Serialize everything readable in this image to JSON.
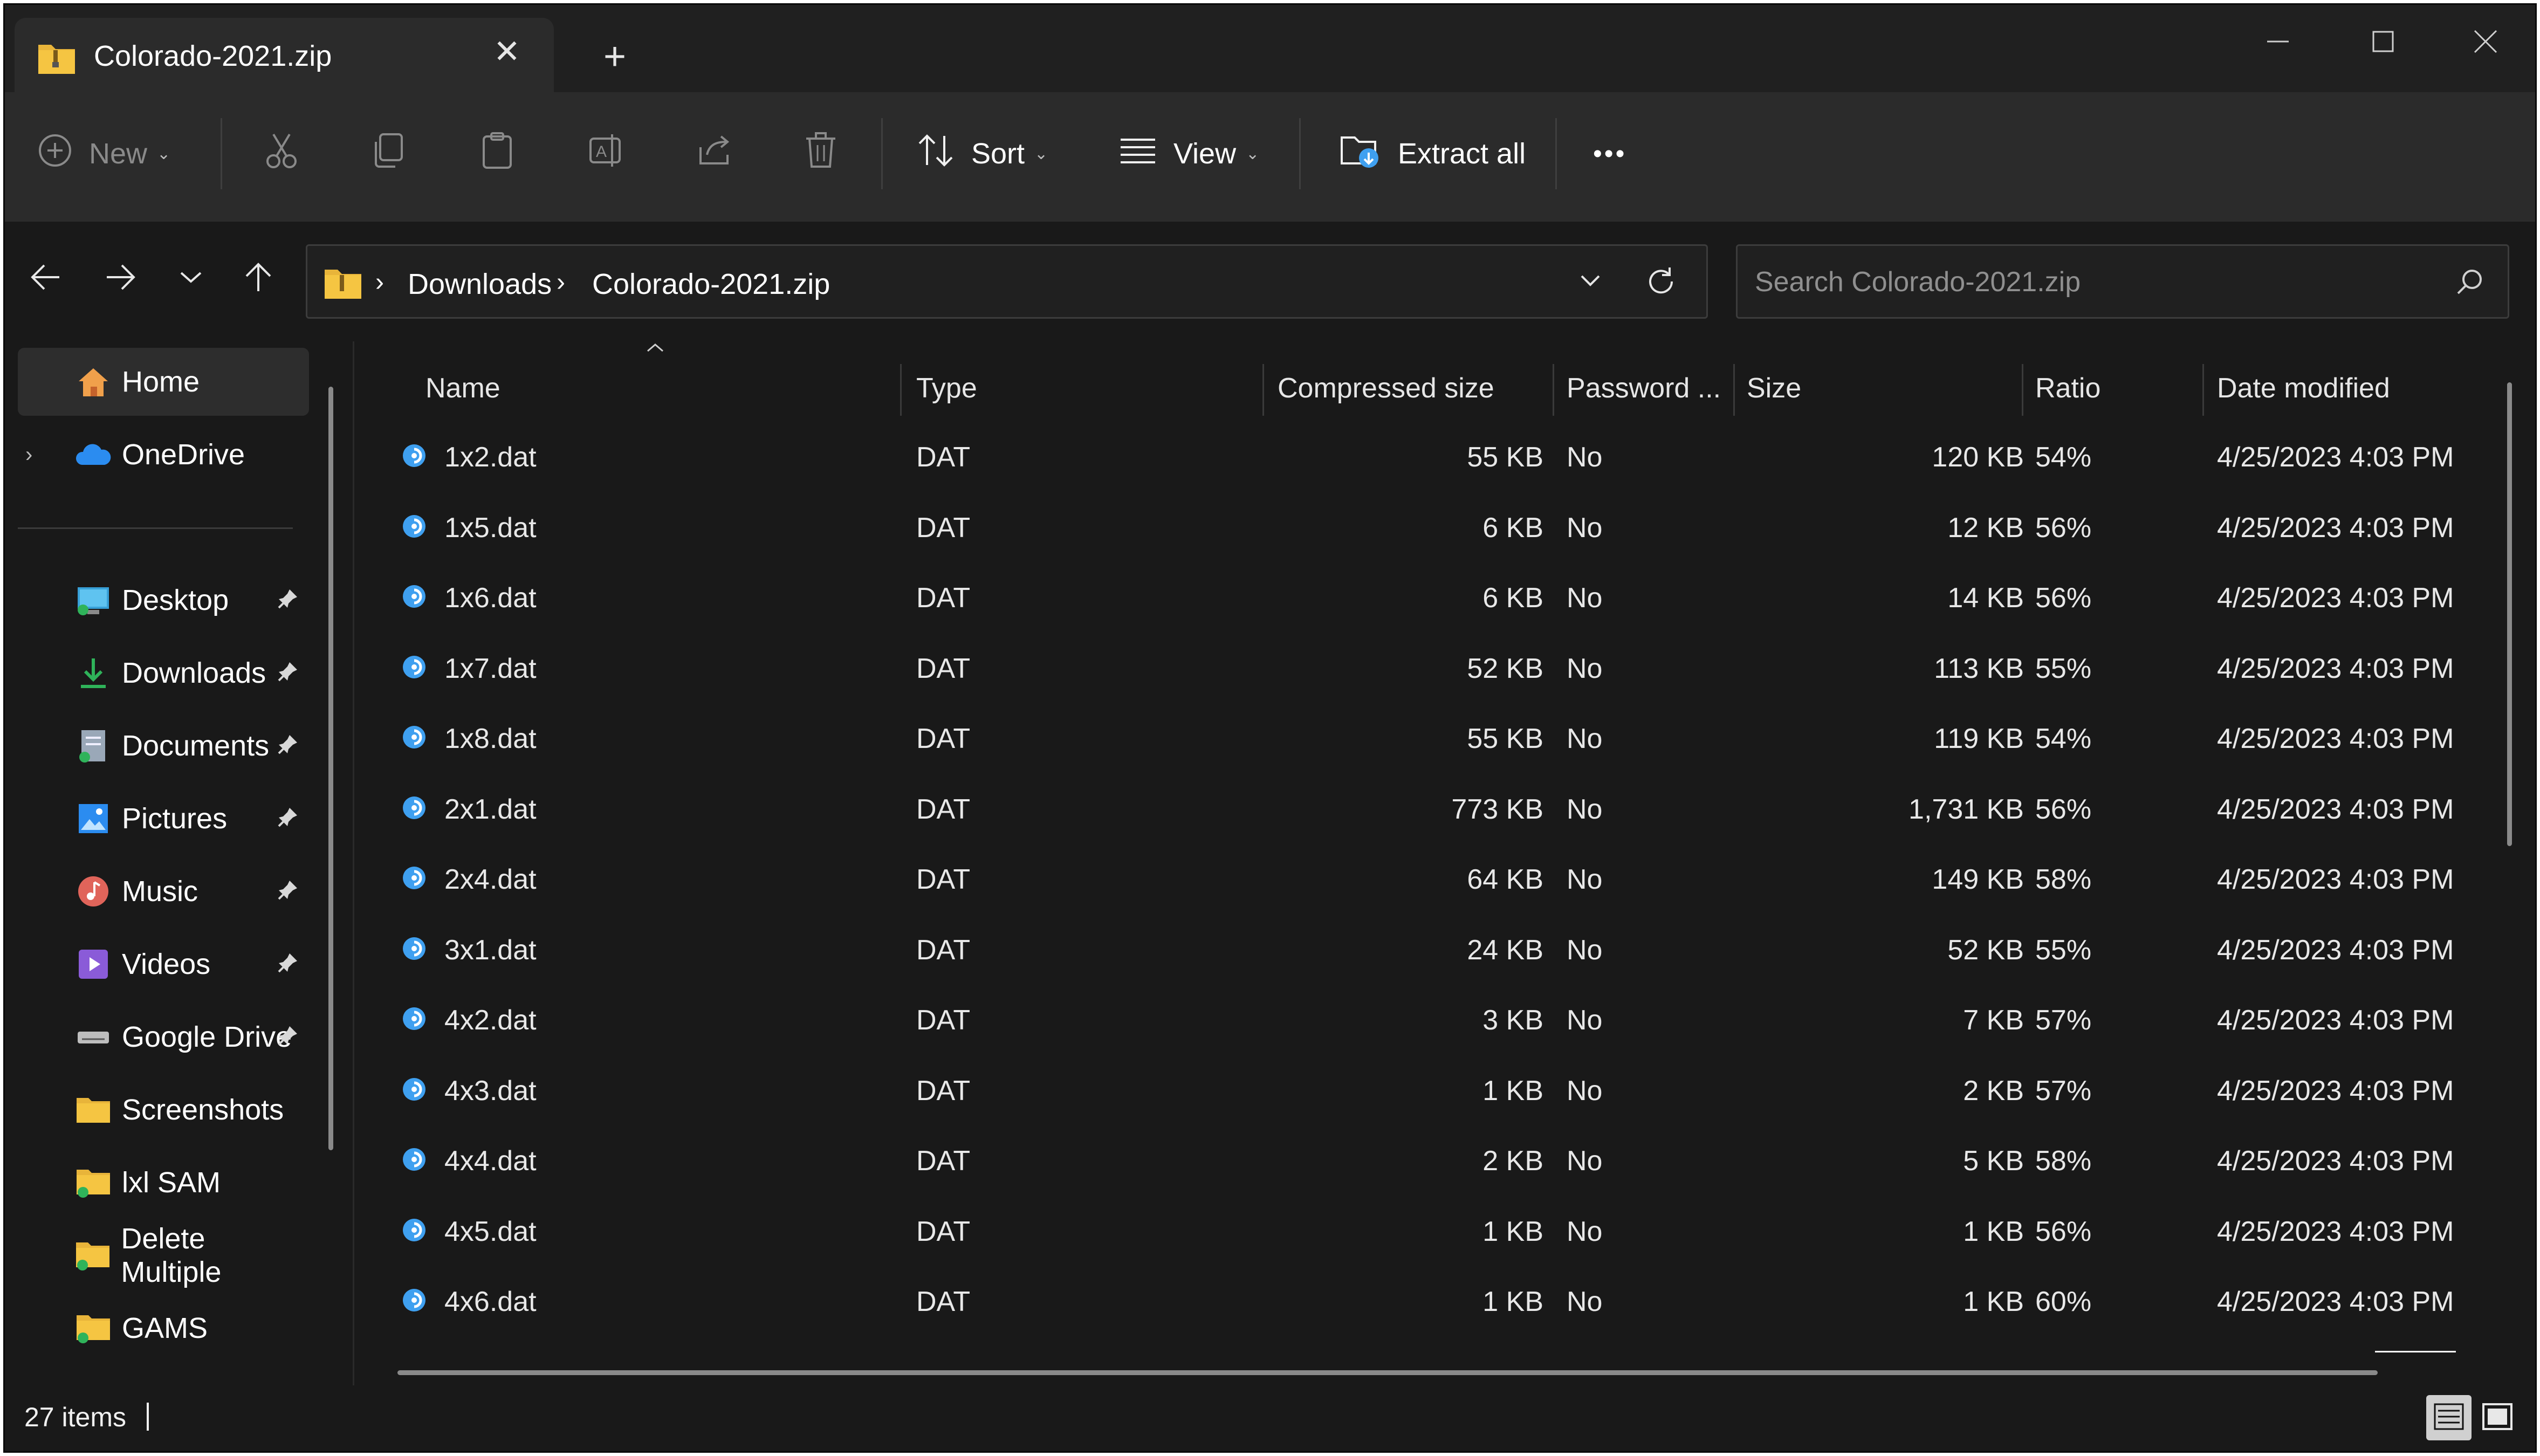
{
  "window": {
    "tab_title": "Colorado-2021.zip",
    "tab_close": "✕",
    "new_tab": "+"
  },
  "toolbar": {
    "new_label": "New",
    "sort_label": "Sort",
    "view_label": "View",
    "extract_label": "Extract all",
    "more_label": "•••"
  },
  "address": {
    "crumbs": [
      "Downloads",
      "Colorado-2021.zip"
    ],
    "separator": "›"
  },
  "search": {
    "placeholder": "Search Colorado-2021.zip"
  },
  "sidebar": {
    "items": [
      {
        "label": "Home",
        "icon": "home-icon",
        "selected": true
      },
      {
        "label": "OneDrive",
        "icon": "cloud-icon"
      },
      {
        "label": "Desktop",
        "icon": "desktop-icon",
        "pinned": true
      },
      {
        "label": "Downloads",
        "icon": "download-icon",
        "pinned": true
      },
      {
        "label": "Documents",
        "icon": "document-icon",
        "pinned": true
      },
      {
        "label": "Pictures",
        "icon": "picture-icon",
        "pinned": true
      },
      {
        "label": "Music",
        "icon": "music-icon",
        "pinned": true
      },
      {
        "label": "Videos",
        "icon": "video-icon",
        "pinned": true
      },
      {
        "label": "Google Drive",
        "icon": "drive-icon",
        "pinned": true
      },
      {
        "label": "Screenshots",
        "icon": "folder-icon"
      },
      {
        "label": "lxl SAM",
        "icon": "folder-icon"
      },
      {
        "label": "Delete Multiple",
        "icon": "folder-icon"
      },
      {
        "label": "GAMS",
        "icon": "folder-icon"
      }
    ]
  },
  "columns": [
    "Name",
    "Type",
    "Compressed size",
    "Password ...",
    "Size",
    "Ratio",
    "Date modified"
  ],
  "files": [
    {
      "name": "1x2.dat",
      "type": "DAT",
      "compressed": "55 KB",
      "password": "No",
      "size": "120 KB",
      "ratio": "54%",
      "date": "4/25/2023 4:03 PM"
    },
    {
      "name": "1x5.dat",
      "type": "DAT",
      "compressed": "6 KB",
      "password": "No",
      "size": "12 KB",
      "ratio": "56%",
      "date": "4/25/2023 4:03 PM"
    },
    {
      "name": "1x6.dat",
      "type": "DAT",
      "compressed": "6 KB",
      "password": "No",
      "size": "14 KB",
      "ratio": "56%",
      "date": "4/25/2023 4:03 PM"
    },
    {
      "name": "1x7.dat",
      "type": "DAT",
      "compressed": "52 KB",
      "password": "No",
      "size": "113 KB",
      "ratio": "55%",
      "date": "4/25/2023 4:03 PM"
    },
    {
      "name": "1x8.dat",
      "type": "DAT",
      "compressed": "55 KB",
      "password": "No",
      "size": "119 KB",
      "ratio": "54%",
      "date": "4/25/2023 4:03 PM"
    },
    {
      "name": "2x1.dat",
      "type": "DAT",
      "compressed": "773 KB",
      "password": "No",
      "size": "1,731 KB",
      "ratio": "56%",
      "date": "4/25/2023 4:03 PM"
    },
    {
      "name": "2x4.dat",
      "type": "DAT",
      "compressed": "64 KB",
      "password": "No",
      "size": "149 KB",
      "ratio": "58%",
      "date": "4/25/2023 4:03 PM"
    },
    {
      "name": "3x1.dat",
      "type": "DAT",
      "compressed": "24 KB",
      "password": "No",
      "size": "52 KB",
      "ratio": "55%",
      "date": "4/25/2023 4:03 PM"
    },
    {
      "name": "4x2.dat",
      "type": "DAT",
      "compressed": "3 KB",
      "password": "No",
      "size": "7 KB",
      "ratio": "57%",
      "date": "4/25/2023 4:03 PM"
    },
    {
      "name": "4x3.dat",
      "type": "DAT",
      "compressed": "1 KB",
      "password": "No",
      "size": "2 KB",
      "ratio": "57%",
      "date": "4/25/2023 4:03 PM"
    },
    {
      "name": "4x4.dat",
      "type": "DAT",
      "compressed": "2 KB",
      "password": "No",
      "size": "5 KB",
      "ratio": "58%",
      "date": "4/25/2023 4:03 PM"
    },
    {
      "name": "4x5.dat",
      "type": "DAT",
      "compressed": "1 KB",
      "password": "No",
      "size": "1 KB",
      "ratio": "56%",
      "date": "4/25/2023 4:03 PM"
    },
    {
      "name": "4x6.dat",
      "type": "DAT",
      "compressed": "1 KB",
      "password": "No",
      "size": "1 KB",
      "ratio": "60%",
      "date": "4/25/2023 4:03 PM"
    }
  ],
  "status": {
    "item_count": "27 items"
  },
  "colors": {
    "background": "#191919",
    "toolbar": "#2b2b2b",
    "accent": "#3fa0f0"
  }
}
